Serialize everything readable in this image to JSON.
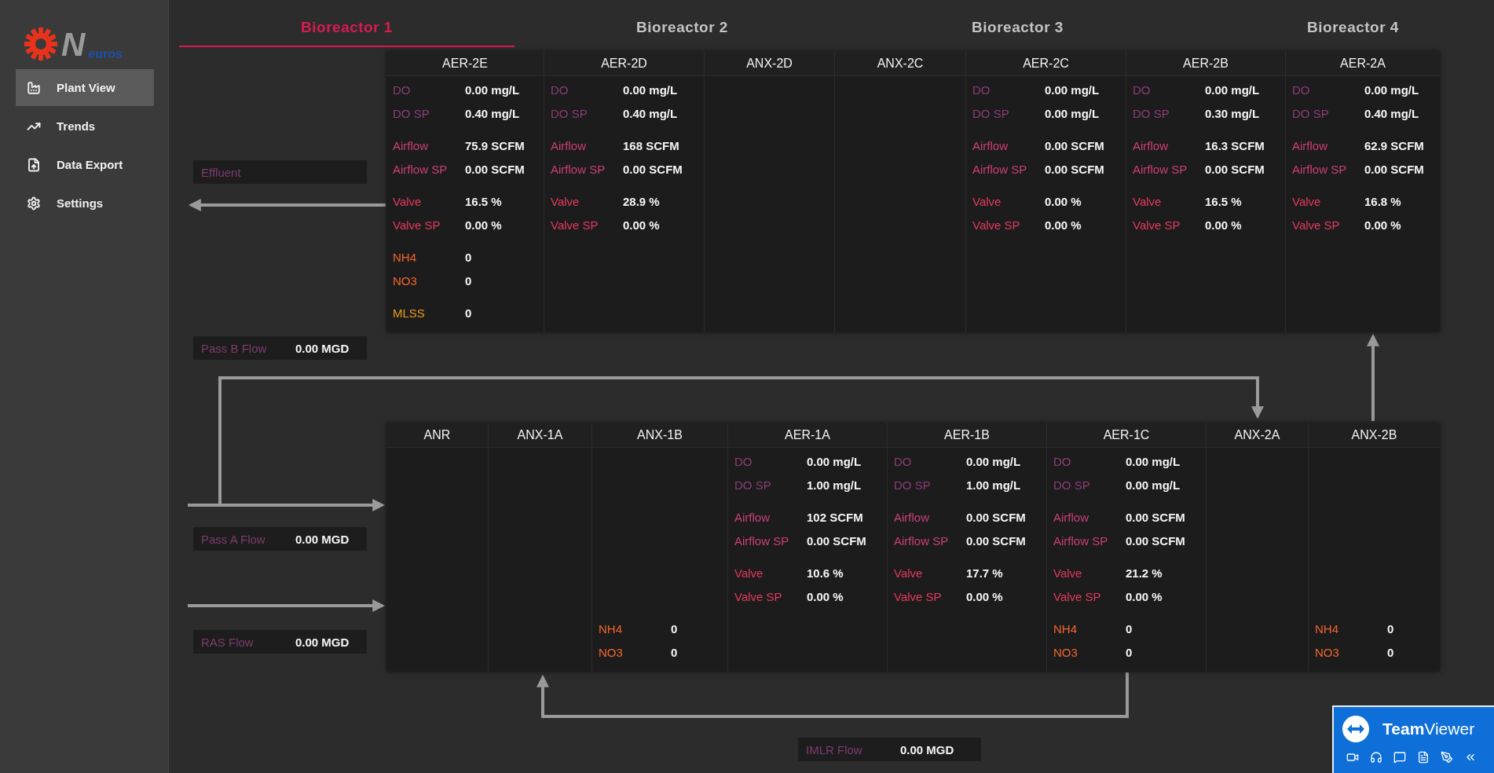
{
  "logo": {
    "letter": "N",
    "word": "euros"
  },
  "sidebar": {
    "items": [
      {
        "label": "Plant View",
        "selected": true
      },
      {
        "label": "Trends",
        "selected": false
      },
      {
        "label": "Data Export",
        "selected": false
      },
      {
        "label": "Settings",
        "selected": false
      }
    ]
  },
  "tabs": [
    {
      "label": "Bioreactor 1",
      "selected": true
    },
    {
      "label": "Bioreactor 2",
      "selected": false
    },
    {
      "label": "Bioreactor 3",
      "selected": false
    },
    {
      "label": "Bioreactor 4",
      "selected": false
    }
  ],
  "flows": [
    {
      "label": "Effluent"
    },
    {
      "label": "Pass B Flow",
      "value": "0.00 MGD"
    },
    {
      "label": "Pass A Flow",
      "value": "0.00 MGD"
    },
    {
      "label": "RAS Flow",
      "value": "0.00 MGD"
    },
    {
      "label": "IMLR Flow",
      "value": "0.00 MGD"
    }
  ],
  "tables": [
    {
      "zones": [
        {
          "name": "AER-2E",
          "readings": [
            {
              "kind": "do",
              "label": "DO",
              "value": "0.00 mg/L"
            },
            {
              "kind": "do",
              "label": "DO SP",
              "value": "0.40 mg/L"
            },
            {
              "kind": "air",
              "label": "Airflow",
              "value": "75.9 SCFM"
            },
            {
              "kind": "air",
              "label": "Airflow SP",
              "value": "0.00 SCFM"
            },
            {
              "kind": "valve",
              "label": "Valve",
              "value": "16.5 %"
            },
            {
              "kind": "valve",
              "label": "Valve SP",
              "value": "0.00 %"
            },
            {
              "kind": "nutrient",
              "label": "NH4",
              "value": "0"
            },
            {
              "kind": "nutrient",
              "label": "NO3",
              "value": "0"
            },
            {
              "kind": "mlss",
              "label": "MLSS",
              "value": "0"
            }
          ]
        },
        {
          "name": "AER-2D",
          "readings": [
            {
              "kind": "do",
              "label": "DO",
              "value": "0.00 mg/L"
            },
            {
              "kind": "do",
              "label": "DO SP",
              "value": "0.40 mg/L"
            },
            {
              "kind": "air",
              "label": "Airflow",
              "value": "168 SCFM"
            },
            {
              "kind": "air",
              "label": "Airflow SP",
              "value": "0.00 SCFM"
            },
            {
              "kind": "valve",
              "label": "Valve",
              "value": "28.9 %"
            },
            {
              "kind": "valve",
              "label": "Valve SP",
              "value": "0.00 %"
            }
          ]
        },
        {
          "name": "ANX-2D"
        },
        {
          "name": "ANX-2C"
        },
        {
          "name": "AER-2C",
          "readings": [
            {
              "kind": "do",
              "label": "DO",
              "value": "0.00 mg/L"
            },
            {
              "kind": "do",
              "label": "DO SP",
              "value": "0.00 mg/L"
            },
            {
              "kind": "air",
              "label": "Airflow",
              "value": "0.00 SCFM"
            },
            {
              "kind": "air",
              "label": "Airflow SP",
              "value": "0.00 SCFM"
            },
            {
              "kind": "valve",
              "label": "Valve",
              "value": "0.00 %"
            },
            {
              "kind": "valve",
              "label": "Valve SP",
              "value": "0.00 %"
            }
          ]
        },
        {
          "name": "AER-2B",
          "readings": [
            {
              "kind": "do",
              "label": "DO",
              "value": "0.00 mg/L"
            },
            {
              "kind": "do",
              "label": "DO SP",
              "value": "0.30 mg/L"
            },
            {
              "kind": "air",
              "label": "Airflow",
              "value": "16.3 SCFM"
            },
            {
              "kind": "air",
              "label": "Airflow SP",
              "value": "0.00 SCFM"
            },
            {
              "kind": "valve",
              "label": "Valve",
              "value": "16.5 %"
            },
            {
              "kind": "valve",
              "label": "Valve SP",
              "value": "0.00 %"
            }
          ]
        },
        {
          "name": "AER-2A",
          "readings": [
            {
              "kind": "do",
              "label": "DO",
              "value": "0.00 mg/L"
            },
            {
              "kind": "do",
              "label": "DO SP",
              "value": "0.40 mg/L"
            },
            {
              "kind": "air",
              "label": "Airflow",
              "value": "62.9 SCFM"
            },
            {
              "kind": "air",
              "label": "Airflow SP",
              "value": "0.00 SCFM"
            },
            {
              "kind": "valve",
              "label": "Valve",
              "value": "16.8 %"
            },
            {
              "kind": "valve",
              "label": "Valve SP",
              "value": "0.00 %"
            }
          ]
        }
      ]
    },
    {
      "zones": [
        {
          "name": "ANR"
        },
        {
          "name": "ANX-1A"
        },
        {
          "name": "ANX-1B",
          "readings": [
            {
              "kind": "nutrient",
              "label": "NH4",
              "value": "0"
            },
            {
              "kind": "nutrient",
              "label": "NO3",
              "value": "0"
            }
          ]
        },
        {
          "name": "AER-1A",
          "readings": [
            {
              "kind": "do",
              "label": "DO",
              "value": "0.00 mg/L"
            },
            {
              "kind": "do",
              "label": "DO SP",
              "value": "1.00 mg/L"
            },
            {
              "kind": "air",
              "label": "Airflow",
              "value": "102 SCFM"
            },
            {
              "kind": "air",
              "label": "Airflow SP",
              "value": "0.00 SCFM"
            },
            {
              "kind": "valve",
              "label": "Valve",
              "value": "10.6 %"
            },
            {
              "kind": "valve",
              "label": "Valve SP",
              "value": "0.00 %"
            }
          ]
        },
        {
          "name": "AER-1B",
          "readings": [
            {
              "kind": "do",
              "label": "DO",
              "value": "0.00 mg/L"
            },
            {
              "kind": "do",
              "label": "DO SP",
              "value": "1.00 mg/L"
            },
            {
              "kind": "air",
              "label": "Airflow",
              "value": "0.00 SCFM"
            },
            {
              "kind": "air",
              "label": "Airflow SP",
              "value": "0.00 SCFM"
            },
            {
              "kind": "valve",
              "label": "Valve",
              "value": "17.7 %"
            },
            {
              "kind": "valve",
              "label": "Valve SP",
              "value": "0.00 %"
            }
          ]
        },
        {
          "name": "AER-1C",
          "readings": [
            {
              "kind": "do",
              "label": "DO",
              "value": "0.00 mg/L"
            },
            {
              "kind": "do",
              "label": "DO SP",
              "value": "0.00 mg/L"
            },
            {
              "kind": "air",
              "label": "Airflow",
              "value": "0.00 SCFM"
            },
            {
              "kind": "air",
              "label": "Airflow SP",
              "value": "0.00 SCFM"
            },
            {
              "kind": "valve",
              "label": "Valve",
              "value": "21.2 %"
            },
            {
              "kind": "valve",
              "label": "Valve SP",
              "value": "0.00 %"
            },
            {
              "kind": "nutrient",
              "label": "NH4",
              "value": "0"
            },
            {
              "kind": "nutrient",
              "label": "NO3",
              "value": "0"
            }
          ]
        },
        {
          "name": "ANX-2A"
        },
        {
          "name": "ANX-2B",
          "readings": [
            {
              "kind": "nutrient",
              "label": "NH4",
              "value": "0"
            },
            {
              "kind": "nutrient",
              "label": "NO3",
              "value": "0"
            }
          ]
        }
      ]
    }
  ],
  "overlay": {
    "title": "**Team**Viewer"
  }
}
